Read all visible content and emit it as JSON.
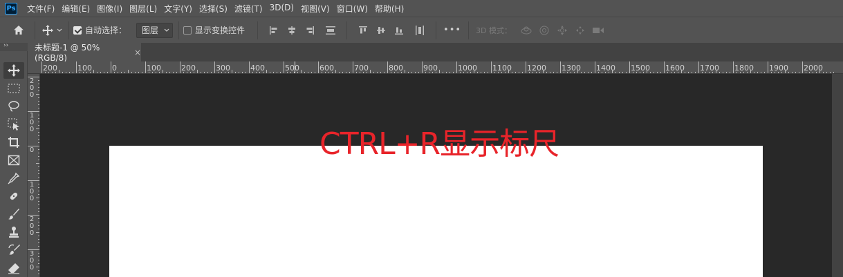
{
  "app": {
    "logo": "Ps"
  },
  "menu": [
    "文件(F)",
    "编辑(E)",
    "图像(I)",
    "图层(L)",
    "文字(Y)",
    "选择(S)",
    "滤镜(T)",
    "3D(D)",
    "视图(V)",
    "窗口(W)",
    "帮助(H)"
  ],
  "options": {
    "auto_select_label": "自动选择：",
    "auto_select_checked": true,
    "layer_select_value": "图层",
    "show_transform_label": "显示变换控件",
    "show_transform_checked": false,
    "more": "•••",
    "mode3d_label": "3D 模式："
  },
  "document_tab": {
    "title": "未标题-1 @ 50%(RGB/8)",
    "close": "×"
  },
  "toolbar": {
    "collapse": "››"
  },
  "ruler_h_labels": [
    "200",
    "100",
    "0",
    "100",
    "200",
    "300",
    "400",
    "500",
    "600",
    "700",
    "800",
    "900",
    "1000",
    "1100",
    "1200",
    "1300",
    "1400",
    "1500",
    "1600",
    "1700",
    "1800",
    "1900",
    "2000"
  ],
  "ruler_v_labels": [
    [
      "2",
      "0",
      "0"
    ],
    [
      "1",
      "0",
      "0"
    ],
    [
      "0"
    ],
    [
      "1",
      "0",
      "0"
    ],
    [
      "2",
      "0",
      "0"
    ],
    [
      "3",
      "0",
      "0"
    ]
  ],
  "overlay_text": "CTRL+R显示标尺",
  "colors": {
    "accent": "#31a8ff",
    "overlay": "#e8242a",
    "panel": "#535353",
    "workspace": "#282828"
  }
}
